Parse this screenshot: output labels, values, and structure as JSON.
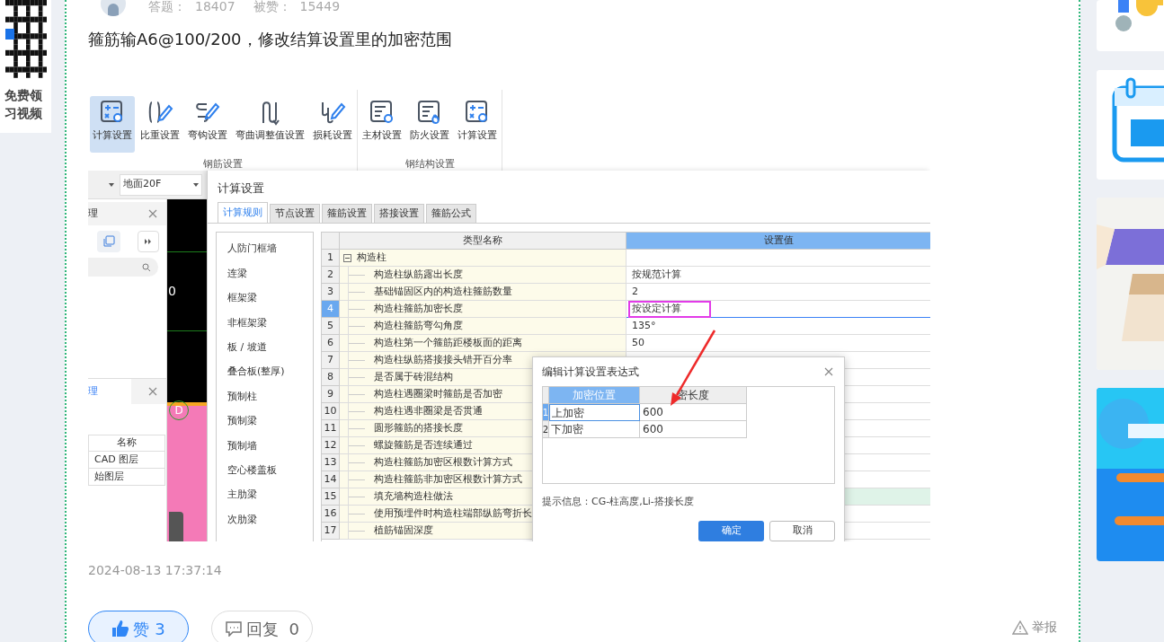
{
  "promo": {
    "lines": [
      "免费领",
      "习视频"
    ]
  },
  "author": {
    "stats": [
      {
        "label": "答题：",
        "value": "18407"
      },
      {
        "label": "被赞：",
        "value": "15449"
      }
    ]
  },
  "answer": {
    "text": "箍筋输A6@100/200，修改结算设置里的加密范围",
    "screenshot": {
      "ribbon": {
        "groups": [
          {
            "title": "钢筋设置",
            "buttons": [
              {
                "label": "计算设置",
                "kind": "calc",
                "selected": true
              },
              {
                "label": "比重设置",
                "kind": "weight",
                "selected": false
              },
              {
                "label": "弯钩设置",
                "kind": "hook",
                "selected": false
              },
              {
                "label": "弯曲调整值设置",
                "kind": "bend",
                "selected": false
              },
              {
                "label": "损耗设置",
                "kind": "loss",
                "selected": false
              }
            ]
          },
          {
            "title": "钢结构设置",
            "buttons": [
              {
                "label": "主材设置",
                "kind": "material",
                "selected": false
              },
              {
                "label": "防火设置",
                "kind": "fire",
                "selected": false
              },
              {
                "label": "计算设置",
                "kind": "calc",
                "selected": false
              }
            ]
          }
        ]
      },
      "app": {
        "floor": "地面20F",
        "top_panel": {
          "tab": "理"
        },
        "layer_panel": {
          "tab": "理",
          "columns": [
            "名称"
          ],
          "rows": [
            "CAD 图层",
            "始图层"
          ]
        },
        "canvas": {
          "label": "0",
          "marker": "D"
        }
      },
      "settings_dialog": {
        "title": "计算设置",
        "tabs": [
          {
            "label": "计算规则",
            "selected": true
          },
          {
            "label": "节点设置",
            "selected": false
          },
          {
            "label": "箍筋设置",
            "selected": false
          },
          {
            "label": "搭接设置",
            "selected": false
          },
          {
            "label": "箍筋公式",
            "selected": false
          }
        ],
        "categories": [
          "人防门框墙",
          "连梁",
          "框架梁",
          "非框架梁",
          "板 / 坡道",
          "叠合板(整厚)",
          "预制柱",
          "预制梁",
          "预制墙",
          "空心楼盖板",
          "主肋梁",
          "次肋梁"
        ],
        "columns": [
          "类型名称",
          "设置值"
        ],
        "rows": [
          {
            "no": "1",
            "kind": "group",
            "name": "构造柱",
            "expanded": true,
            "selected": false,
            "boxed": false,
            "highlighted": false
          },
          {
            "no": "2",
            "kind": "item",
            "name": "构造柱纵筋露出长度",
            "value": "按规范计算",
            "selected": false,
            "boxed": false,
            "highlighted": false
          },
          {
            "no": "3",
            "kind": "item",
            "name": "基础锚固区内的构造柱箍筋数量",
            "value": "2",
            "selected": false,
            "boxed": false,
            "highlighted": false
          },
          {
            "no": "4",
            "kind": "item",
            "name": "构造柱箍筋加密长度",
            "value": "按设定计算",
            "selected": true,
            "boxed": true,
            "highlighted": false
          },
          {
            "no": "5",
            "kind": "item",
            "name": "构造柱箍筋弯勾角度",
            "value": "135°",
            "selected": false,
            "boxed": false,
            "highlighted": false
          },
          {
            "no": "6",
            "kind": "item",
            "name": "构造柱第一个箍筋距楼板面的距离",
            "value": "50",
            "selected": false,
            "boxed": false,
            "highlighted": false
          },
          {
            "no": "7",
            "kind": "item",
            "name": "构造柱纵筋搭接接头错开百分率",
            "selected": false,
            "highlighted": false
          },
          {
            "no": "8",
            "kind": "item",
            "name": "是否属于砖混结构",
            "selected": false,
            "highlighted": false
          },
          {
            "no": "9",
            "kind": "item",
            "name": "构造柱遇圈梁时箍筋是否加密",
            "selected": false,
            "highlighted": false
          },
          {
            "no": "10",
            "kind": "item",
            "name": "构造柱遇非圈梁是否贯通",
            "selected": false,
            "highlighted": false
          },
          {
            "no": "11",
            "kind": "item",
            "name": "圆形箍筋的搭接长度",
            "selected": false,
            "highlighted": false
          },
          {
            "no": "12",
            "kind": "item",
            "name": "螺旋箍筋是否连续通过",
            "selected": false,
            "highlighted": false
          },
          {
            "no": "13",
            "kind": "item",
            "name": "构造柱箍筋加密区根数计算方式",
            "selected": false,
            "highlighted": false
          },
          {
            "no": "14",
            "kind": "item",
            "name": "构造柱箍筋非加密区根数计算方式",
            "selected": false,
            "highlighted": false
          },
          {
            "no": "15",
            "kind": "item",
            "name": "填充墙构造柱做法",
            "selected": false,
            "highlighted": true
          },
          {
            "no": "16",
            "kind": "item",
            "name": "使用预埋件时构造柱端部纵筋弯折长",
            "selected": false,
            "highlighted": false
          },
          {
            "no": "17",
            "kind": "item",
            "name": "植筋锚固深度",
            "selected": false,
            "highlighted": false
          }
        ]
      },
      "expr_dialog": {
        "title": "编辑计算设置表达式",
        "columns": [
          {
            "label": "加密位置",
            "selected": true
          },
          {
            "label": "密长度",
            "selected": false
          }
        ],
        "rows": [
          {
            "no": "1",
            "position": "上加密",
            "length": "600",
            "selected": true
          },
          {
            "no": "2",
            "position": "下加密",
            "length": "600",
            "selected": false
          }
        ],
        "hint": "提示信息：CG-柱高度,Li-搭接长度",
        "buttons": [
          {
            "label": "确定",
            "kind": "primary"
          },
          {
            "label": "取消",
            "kind": "secondary"
          }
        ]
      }
    },
    "timestamp": "2024-08-13 17:37:14",
    "like": {
      "label": "赞",
      "count": "3"
    },
    "reply": {
      "label": "回复",
      "count": "0"
    },
    "report": "举报"
  }
}
